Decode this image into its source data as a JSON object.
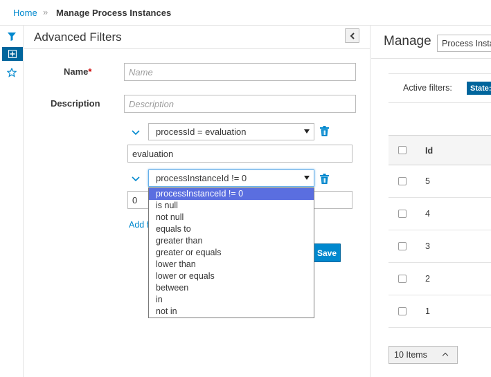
{
  "breadcrumb": {
    "home": "Home",
    "separator": "»",
    "current": "Manage Process Instances"
  },
  "filters": {
    "title": "Advanced Filters",
    "name_label": "Name",
    "required_marker": "*",
    "name_placeholder": "Name",
    "description_label": "Description",
    "description_placeholder": "Description",
    "filter1": {
      "selected": "processId = evaluation",
      "value": "evaluation"
    },
    "filter2": {
      "selected": "processInstanceId != 0",
      "value": "0"
    },
    "add_link": "Add f",
    "save_label": "Save",
    "dropdown_options": [
      "processInstanceId != 0",
      "is null",
      "not null",
      "equals to",
      "greater than",
      "greater or equals",
      "lower than",
      "lower or equals",
      "between",
      "in",
      "not in"
    ]
  },
  "list": {
    "title": "Manage",
    "name_field_value": "Process Insta",
    "active_filters_label": "Active filters:",
    "state_badge": "State:",
    "column_id": "Id",
    "rows": [
      "5",
      "4",
      "3",
      "2",
      "1"
    ],
    "pager_label": "10 Items"
  },
  "colors": {
    "accent": "#0088ce",
    "dark_accent": "#00659c",
    "selected_option": "#5a6ee0"
  }
}
